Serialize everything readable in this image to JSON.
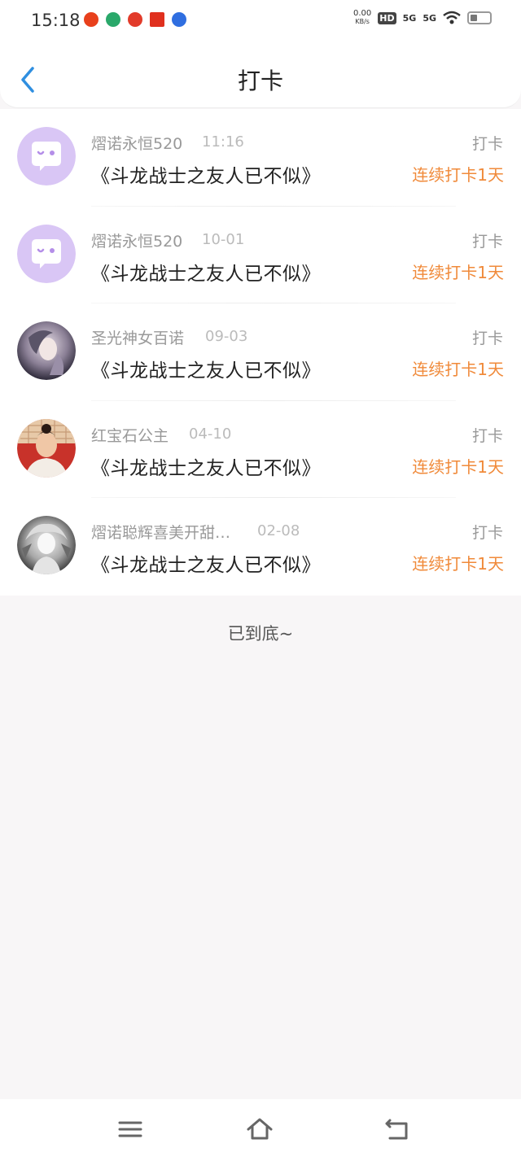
{
  "status_bar": {
    "time": "15:18",
    "net_speed_value": "0.00",
    "net_speed_unit": "KB/s",
    "hd": "HD",
    "sim1": "5G",
    "sim2": "5G"
  },
  "header": {
    "title": "打卡"
  },
  "list": {
    "items": [
      {
        "name": "熠诺永恒520",
        "time": "11:16",
        "book": "《斗龙战士之友人已不似》",
        "action": "打卡",
        "streak": "连续打卡1天",
        "avatar": "default-chat-avatar"
      },
      {
        "name": "熠诺永恒520",
        "time": "10-01",
        "book": "《斗龙战士之友人已不似》",
        "action": "打卡",
        "streak": "连续打卡1天",
        "avatar": "default-chat-avatar"
      },
      {
        "name": "圣光神女百诺",
        "time": "09-03",
        "book": "《斗龙战士之友人已不似》",
        "action": "打卡",
        "streak": "连续打卡1天",
        "avatar": "photo-avatar"
      },
      {
        "name": "红宝石公主",
        "time": "04-10",
        "book": "《斗龙战士之友人已不似》",
        "action": "打卡",
        "streak": "连续打卡1天",
        "avatar": "photo-avatar"
      },
      {
        "name": "熠诺聪辉喜美开甜…",
        "time": "02-08",
        "book": "《斗龙战士之友人已不似》",
        "action": "打卡",
        "streak": "连续打卡1天",
        "avatar": "photo-avatar"
      }
    ]
  },
  "footer": {
    "end_text": "已到底~"
  },
  "colors": {
    "accent": "#f08a3a",
    "back": "#2f8fe0",
    "avatar_bg": "#d9c6f5"
  }
}
